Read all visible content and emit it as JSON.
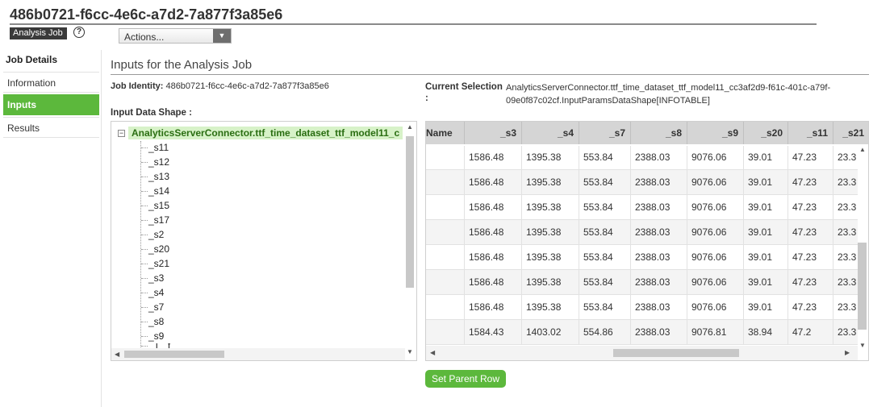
{
  "header": {
    "title": "486b0721-f6cc-4e6c-a7d2-7a877f3a85e6",
    "type_badge": "Analysis Job",
    "help_glyph": "?",
    "actions_label": "Actions..."
  },
  "sidebar": {
    "title": "Job Details",
    "items": [
      {
        "label": "Information",
        "active": false
      },
      {
        "label": "Inputs",
        "active": true
      },
      {
        "label": "Results",
        "active": false
      }
    ]
  },
  "main": {
    "section_title": "Inputs for the Analysis Job",
    "job_identity_label": "Job Identity:",
    "job_identity_value": "486b0721-f6cc-4e6c-a7d2-7a877f3a85e6",
    "input_shape_label": "Input Data Shape :",
    "current_selection_label": "Current Selection :",
    "current_selection_value": "AnalyticsServerConnector.ttf_time_dataset_ttf_model11_cc3af2d9-f61c-401c-a79f-09e0f87c02cf.InputParamsDataShape[INFOTABLE]",
    "set_parent_row_label": "Set Parent Row"
  },
  "tree": {
    "root_label": "AnalyticsServerConnector.ttf_time_dataset_ttf_model11_c",
    "expander": "−",
    "nodes": [
      "_s11",
      "_s12",
      "_s13",
      "_s14",
      "_s15",
      "_s17",
      "_s2",
      "_s20",
      "_s21",
      "_s3",
      "_s4",
      "_s7",
      "_s8",
      "_s9"
    ],
    "partial_node": "_T_ t_"
  },
  "grid": {
    "columns": [
      "Name",
      "_s3",
      "_s4",
      "_s7",
      "_s8",
      "_s9",
      "_s20",
      "_s11",
      "_s21"
    ],
    "rows": [
      [
        "",
        "1586.48",
        "1395.38",
        "553.84",
        "2388.03",
        "9076.06",
        "39.01",
        "47.23",
        "23.3"
      ],
      [
        "",
        "1586.48",
        "1395.38",
        "553.84",
        "2388.03",
        "9076.06",
        "39.01",
        "47.23",
        "23.3"
      ],
      [
        "",
        "1586.48",
        "1395.38",
        "553.84",
        "2388.03",
        "9076.06",
        "39.01",
        "47.23",
        "23.3"
      ],
      [
        "",
        "1586.48",
        "1395.38",
        "553.84",
        "2388.03",
        "9076.06",
        "39.01",
        "47.23",
        "23.3"
      ],
      [
        "",
        "1586.48",
        "1395.38",
        "553.84",
        "2388.03",
        "9076.06",
        "39.01",
        "47.23",
        "23.3"
      ],
      [
        "",
        "1586.48",
        "1395.38",
        "553.84",
        "2388.03",
        "9076.06",
        "39.01",
        "47.23",
        "23.3"
      ],
      [
        "",
        "1586.48",
        "1395.38",
        "553.84",
        "2388.03",
        "9076.06",
        "39.01",
        "47.23",
        "23.3"
      ],
      [
        "",
        "1584.43",
        "1403.02",
        "554.86",
        "2388.03",
        "9076.81",
        "38.94",
        "47.2",
        "23.3"
      ]
    ]
  },
  "icons": {
    "up": "▲",
    "down": "▼",
    "left": "◀",
    "right": "▶"
  },
  "colors": {
    "accent_green": "#5cb83c",
    "badge_dark": "#3a3a3a",
    "tree_highlight": "#d7f2c8",
    "header_gray": "#d5d5d5"
  }
}
